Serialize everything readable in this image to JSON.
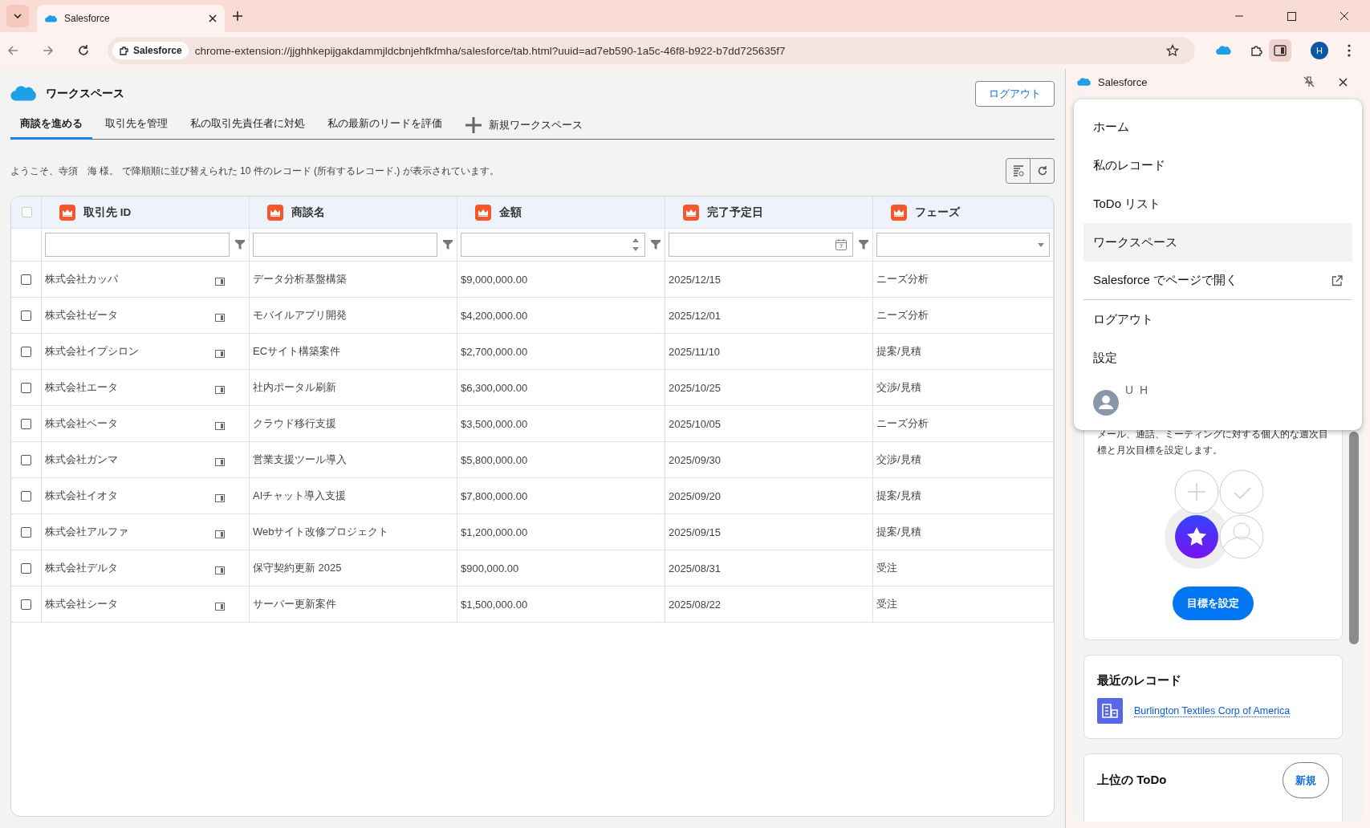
{
  "browser": {
    "tab": {
      "title": "Salesforce"
    },
    "site_chip": "Salesforce",
    "url": "chrome-extension://jjghhkepijgakdammjldcbnjehfkfmha/salesforce/tab.html?uuid=ad7eb590-1a5c-46f8-b922-b7dd725635f7",
    "profile": "H"
  },
  "workspace": {
    "title": "ワークスペース",
    "logout": "ログアウト",
    "tabs": [
      {
        "label": "商談を進める",
        "selected": true
      },
      {
        "label": "取引先を管理",
        "selected": false
      },
      {
        "label": "私の取引先責任者に対処",
        "selected": false
      },
      {
        "label": "私の最新のリードを評価",
        "selected": false
      }
    ],
    "new_tab": "新規ワークスペース",
    "message": "ようこそ、寺須　海 様。 で降順順に並び替えられた 10 件のレコード (所有するレコード.) が表示されています。"
  },
  "table": {
    "select_all": {
      "checked": false
    },
    "columns": [
      {
        "label": "取引先 ID",
        "kind": "text"
      },
      {
        "label": "商談名",
        "kind": "text"
      },
      {
        "label": "金額",
        "kind": "number"
      },
      {
        "label": "完了予定日",
        "kind": "date"
      },
      {
        "label": "フェーズ",
        "kind": "select"
      }
    ],
    "rows": [
      {
        "checked": false,
        "cells": [
          "株式会社カッパ",
          "データ分析基盤構築",
          "$9,000,000.00",
          "2025/12/15",
          "ニーズ分析"
        ]
      },
      {
        "checked": false,
        "cells": [
          "株式会社ゼータ",
          "モバイルアプリ開発",
          "$4,200,000.00",
          "2025/12/01",
          "ニーズ分析"
        ]
      },
      {
        "checked": false,
        "cells": [
          "株式会社イプシロン",
          "ECサイト構築案件",
          "$2,700,000.00",
          "2025/11/10",
          "提案/見積"
        ]
      },
      {
        "checked": false,
        "cells": [
          "株式会社エータ",
          "社内ポータル刷新",
          "$6,300,000.00",
          "2025/10/25",
          "交渉/見積"
        ]
      },
      {
        "checked": false,
        "cells": [
          "株式会社ベータ",
          "クラウド移行支援",
          "$3,500,000.00",
          "2025/10/05",
          "ニーズ分析"
        ]
      },
      {
        "checked": false,
        "cells": [
          "株式会社ガンマ",
          "営業支援ツール導入",
          "$5,800,000.00",
          "2025/09/30",
          "交渉/見積"
        ]
      },
      {
        "checked": false,
        "cells": [
          "株式会社イオタ",
          "AIチャット導入支援",
          "$7,800,000.00",
          "2025/09/20",
          "提案/見積"
        ]
      },
      {
        "checked": false,
        "cells": [
          "株式会社アルファ",
          "Webサイト改修プロジェクト",
          "$1,200,000.00",
          "2025/09/15",
          "提案/見積"
        ]
      },
      {
        "checked": false,
        "cells": [
          "株式会社デルタ",
          "保守契約更新 2025",
          "$900,000.00",
          "2025/08/31",
          "受注"
        ]
      },
      {
        "checked": false,
        "cells": [
          "株式会社シータ",
          "サーバー更新案件",
          "$1,500,000.00",
          "2025/08/22",
          "受注"
        ]
      }
    ]
  },
  "side_panel": {
    "title": "Salesforce",
    "menu": [
      {
        "label": "ホーム",
        "selected": false,
        "external": false
      },
      {
        "label": "私のレコード",
        "selected": false,
        "external": false
      },
      {
        "label": "ToDo リスト",
        "selected": false,
        "external": false
      },
      {
        "label": "ワークスペース",
        "selected": true,
        "external": false
      },
      {
        "label": "Salesforce でページで開く",
        "selected": false,
        "external": true
      },
      {
        "label": "ログアウト",
        "selected": false,
        "external": false
      },
      {
        "label": "設定",
        "selected": false,
        "external": false
      }
    ],
    "user": "U H",
    "goals": {
      "description": "メール、通話、ミーティングに対する個人的な週次目標と月次目標を設定します。",
      "button": "目標を設定"
    },
    "recent": {
      "title": "最近のレコード",
      "records": [
        "Burlington Textiles Corp of America"
      ]
    },
    "todo": {
      "title": "上位の ToDo",
      "button": "新規"
    }
  }
}
